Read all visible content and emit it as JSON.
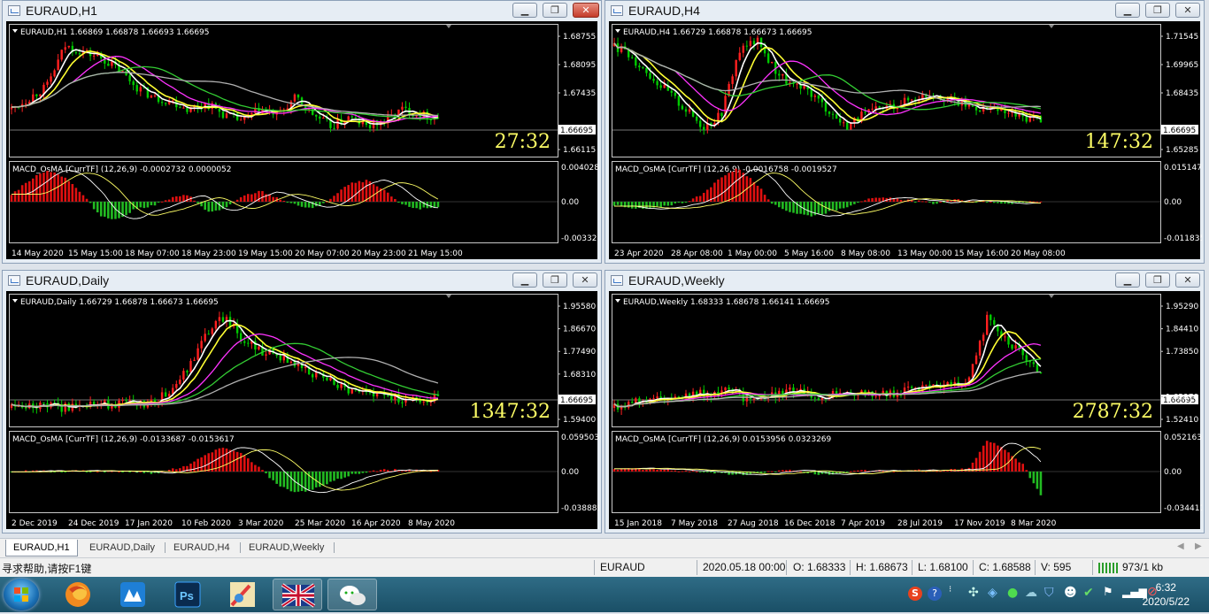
{
  "windows": [
    {
      "id": "h1",
      "title": "EURAUD,H1",
      "info": "EURAUD,H1  1.66869 1.66878 1.66693 1.66695",
      "timer": "27:32",
      "price_ticks": [
        "1.68755",
        "1.68095",
        "1.67435",
        "1.66695",
        "1.66115"
      ],
      "current_price": "1.66695",
      "macd_label": "MACD_OsMA [CurrTF] (12,26,9) -0.0002732 0.0000052",
      "macd_ticks": [
        "0.004028",
        "0.00",
        "-0.00332"
      ],
      "time_labels": [
        "14 May 2020",
        "15 May 15:00",
        "18 May 07:00",
        "18 May 23:00",
        "19 May 15:00",
        "20 May 07:00",
        "20 May 23:00",
        "21 May 15:00"
      ],
      "active": true
    },
    {
      "id": "h4",
      "title": "EURAUD,H4",
      "info": "EURAUD,H4  1.66729 1.66878 1.66673 1.66695",
      "timer": "147:32",
      "price_ticks": [
        "1.71545",
        "1.69965",
        "1.68435",
        "1.66695",
        "1.65285"
      ],
      "current_price": "1.66695",
      "macd_label": "MACD_OsMA [CurrTF] (12,26,9) -0.0016758 -0.0019527",
      "macd_ticks": [
        "0.0151478",
        "0.00",
        "-0.011835"
      ],
      "time_labels": [
        "23 Apr 2020",
        "28 Apr 08:00",
        "1 May 00:00",
        "5 May 16:00",
        "8 May 08:00",
        "13 May 00:00",
        "15 May 16:00",
        "20 May 08:00"
      ],
      "active": false
    },
    {
      "id": "daily",
      "title": "EURAUD,Daily",
      "info": "EURAUD,Daily  1.66729 1.66878 1.66673 1.66695",
      "timer": "1347:32",
      "price_ticks": [
        "1.95580",
        "1.86670",
        "1.77490",
        "1.68310",
        "1.66695",
        "1.59400"
      ],
      "current_price": "1.66695",
      "macd_label": "MACD_OsMA [CurrTF] (12,26,9) -0.0133687 -0.0153617",
      "macd_ticks": [
        "0.0595038",
        "0.00",
        "-0.038889"
      ],
      "time_labels": [
        "2 Dec 2019",
        "24 Dec 2019",
        "17 Jan 2020",
        "10 Feb 2020",
        "3 Mar 2020",
        "25 Mar 2020",
        "16 Apr 2020",
        "8 May 2020"
      ],
      "active": false
    },
    {
      "id": "weekly",
      "title": "EURAUD,Weekly",
      "info": "EURAUD,Weekly  1.68333 1.68678 1.66141 1.66695",
      "timer": "2787:32",
      "price_ticks": [
        "1.95290",
        "1.84410",
        "1.73850",
        "1.66695",
        "1.62970",
        "1.52410"
      ],
      "current_price": "1.66695",
      "macd_label": "MACD_OsMA [CurrTF] (12,26,9) 0.0153956 0.0323269",
      "macd_ticks": [
        "0.0521638",
        "0.00",
        "-0.034411"
      ],
      "time_labels": [
        "15 Jan 2018",
        "7 May 2018",
        "27 Aug 2018",
        "16 Dec 2018",
        "7 Apr 2019",
        "28 Jul 2019",
        "17 Nov 2019",
        "8 Mar 2020"
      ],
      "active": false
    }
  ],
  "tabs": [
    "EURAUD,H1",
    "EURAUD,Daily",
    "EURAUD,H4",
    "EURAUD,Weekly"
  ],
  "status": {
    "help": "寻求帮助,请按F1键",
    "symbol": "EURAUD",
    "datetime": "2020.05.18 00:00",
    "open": "O: 1.68333",
    "high": "H: 1.68673",
    "low": "L: 1.68100",
    "close": "C: 1.68588",
    "volume": "V: 595",
    "traffic": "973/1 kb"
  },
  "taskbar": {
    "apps": [
      "firefox-icon",
      "app-icon",
      "photoshop-icon",
      "paint-icon",
      "flag-icon",
      "wechat-icon"
    ],
    "ps_label": "Ps",
    "time": "6:32",
    "date": "2020/5/22"
  },
  "colors": {
    "bull": "#00cc00",
    "bear": "#ff2020",
    "ma_white": "#ffffff",
    "ma_yellow": "#ffff33",
    "ma_magenta": "#ff33ff",
    "ma_green": "#33cc33",
    "ma_gray": "#b0b0b0",
    "timer": "#ffff66"
  }
}
